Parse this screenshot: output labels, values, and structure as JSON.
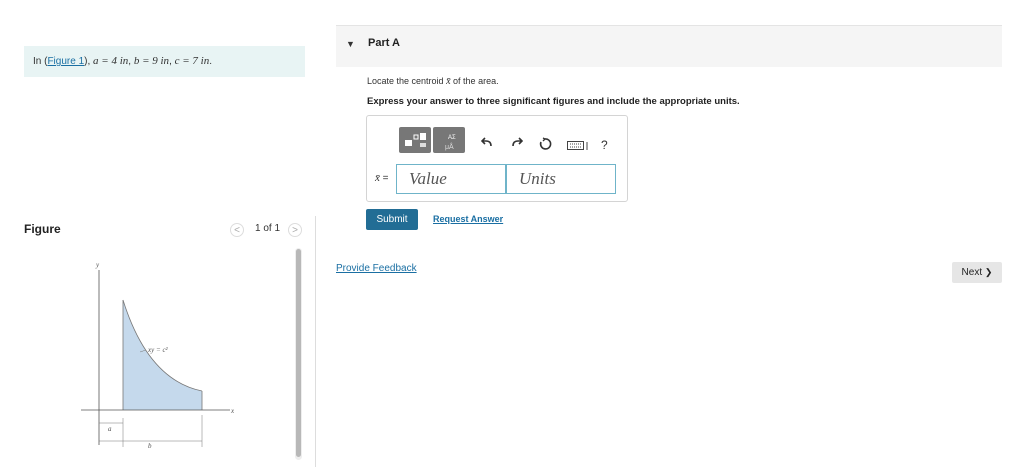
{
  "problem": {
    "prefix": "In (",
    "figure_link": "Figure 1",
    "suffix": "), ",
    "a_eq": "a = 4 in",
    "b_eq": "b = 9 in",
    "c_eq": "c = 7 in",
    "sep": ", ",
    "end": "."
  },
  "figure_panel": {
    "title": "Figure",
    "pager_text": "1 of 1",
    "prev_glyph": "<",
    "next_glyph": ">",
    "figure": {
      "axis_y": "y",
      "axis_x": "x",
      "curve_label": "xy = c²",
      "dim_a": "a",
      "dim_b": "b",
      "fill_color": "#c5d9ec"
    }
  },
  "part": {
    "label": "Part A",
    "toggle_glyph": "▼",
    "question": "Locate the centroid",
    "question_var": "x̄",
    "question_end": "of the area.",
    "instruction": "Express your answer to three significant figures and include the appropriate units.",
    "answer": {
      "label_var": "x̄",
      "label_eq": " =",
      "value_placeholder": "Value",
      "units_placeholder": "Units",
      "help_glyph": "?"
    },
    "submit_label": "Submit",
    "request_label": "Request Answer"
  },
  "feedback_label": "Provide Feedback",
  "next_label": "Next",
  "next_glyph": "❯",
  "colors": {
    "accent": "#226d95",
    "link": "#1a6fa3",
    "problem_bg": "#e8f4f4"
  }
}
